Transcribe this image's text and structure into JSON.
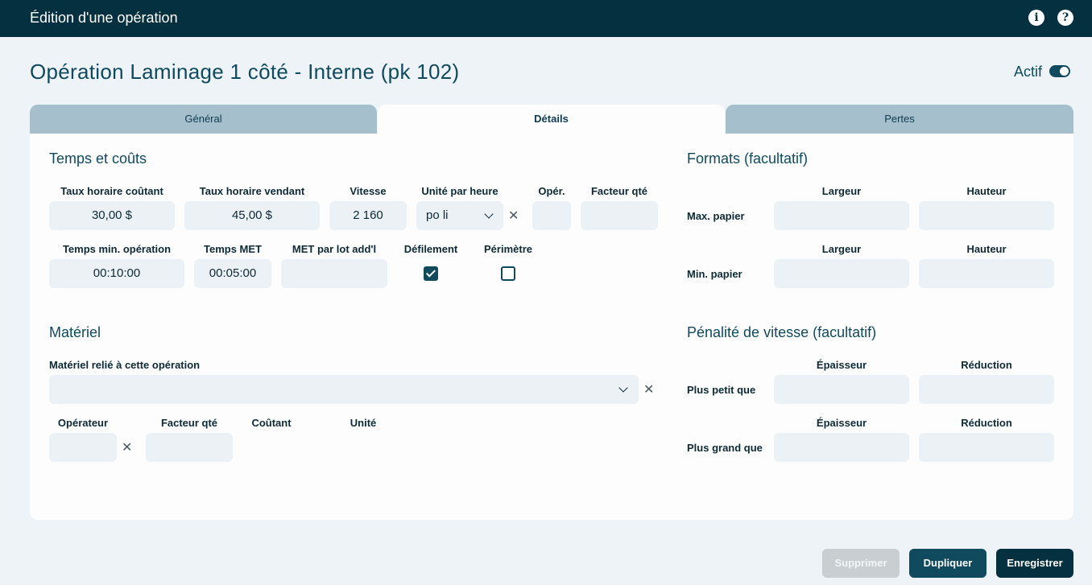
{
  "topbar": {
    "title": "Édition d'une opération",
    "info_icon": "info-icon",
    "help_icon": "help-icon"
  },
  "page": {
    "title": "Opération Laminage 1 côté - Interne (pk 102)",
    "active_label": "Actif",
    "active": true
  },
  "tabs": [
    {
      "label": "Général",
      "active": false
    },
    {
      "label": "Détails",
      "active": true
    },
    {
      "label": "Pertes",
      "active": false
    }
  ],
  "temps_couts": {
    "title": "Temps et coûts",
    "taux_horaire_coutant": {
      "label": "Taux horaire coûtant",
      "value": "30,00 $"
    },
    "taux_horaire_vendant": {
      "label": "Taux horaire vendant",
      "value": "45,00 $"
    },
    "vitesse": {
      "label": "Vitesse",
      "value": "2 160"
    },
    "unite_par_heure": {
      "label": "Unité par heure",
      "value": "po li"
    },
    "oper": {
      "label": "Opér.",
      "value": ""
    },
    "facteur_qte": {
      "label": "Facteur qté",
      "value": ""
    },
    "temps_min_operation": {
      "label": "Temps min. opération",
      "value": "00:10:00"
    },
    "temps_met": {
      "label": "Temps MET",
      "value": "00:05:00"
    },
    "met_par_lot": {
      "label": "MET par lot add'l",
      "value": ""
    },
    "defilement": {
      "label": "Défilement",
      "checked": true
    },
    "perimetre": {
      "label": "Périmètre",
      "checked": false
    }
  },
  "materiel": {
    "title": "Matériel",
    "relie_label": "Matériel relié à cette opération",
    "relie_value": "",
    "operateur_label": "Opérateur",
    "facteur_qte_label": "Facteur qté",
    "coutant_label": "Coûtant",
    "unite_label": "Unité"
  },
  "formats": {
    "title": "Formats (facultatif)",
    "max_label": "Max. papier",
    "min_label": "Min. papier",
    "largeur_label": "Largeur",
    "hauteur_label": "Hauteur"
  },
  "penalite": {
    "title": "Pénalité de vitesse (facultatif)",
    "plus_petit_label": "Plus petit que",
    "plus_grand_label": "Plus grand que",
    "epaisseur_label": "Épaisseur",
    "reduction_label": "Réduction"
  },
  "actions": {
    "supprimer": "Supprimer",
    "dupliquer": "Dupliquer",
    "enregistrer": "Enregistrer"
  },
  "colors": {
    "topbar": "#04303f",
    "accent": "#0f4a5e",
    "tab_inactive": "#a6bfcc",
    "field_bg": "#ebf1f5",
    "dupliquer_bg": "#0f4a5e",
    "enregistrer_bg": "#04303f",
    "supprimer_bg": "#c9ced1"
  }
}
